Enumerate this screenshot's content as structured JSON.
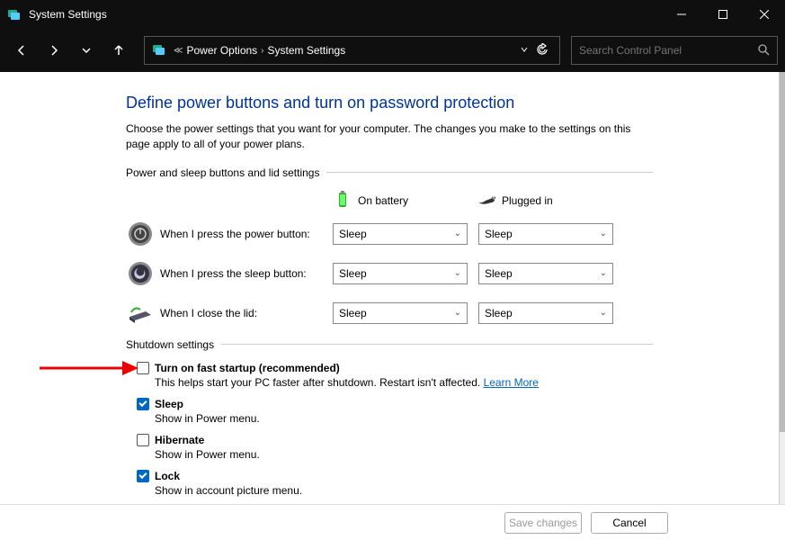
{
  "titlebar": {
    "text": "System Settings"
  },
  "breadcrumb": {
    "part1": "Power Options",
    "part2": "System Settings"
  },
  "search": {
    "placeholder": "Search Control Panel"
  },
  "page": {
    "heading": "Define power buttons and turn on password protection",
    "intro": "Choose the power settings that you want for your computer. The changes you make to the settings on this page apply to all of your power plans.",
    "section1": "Power and sleep buttons and lid settings",
    "col_battery": "On battery",
    "col_plugged": "Plugged in",
    "rows": [
      {
        "label": "When I press the power button:",
        "battery": "Sleep",
        "plugged": "Sleep"
      },
      {
        "label": "When I press the sleep button:",
        "battery": "Sleep",
        "plugged": "Sleep"
      },
      {
        "label": "When I close the lid:",
        "battery": "Sleep",
        "plugged": "Sleep"
      }
    ],
    "section2": "Shutdown settings",
    "shutdown": [
      {
        "label": "Turn on fast startup (recommended)",
        "desc": "This helps start your PC faster after shutdown. Restart isn't affected. ",
        "link": "Learn More",
        "checked": false
      },
      {
        "label": "Sleep",
        "desc": "Show in Power menu.",
        "checked": true
      },
      {
        "label": "Hibernate",
        "desc": "Show in Power menu.",
        "checked": false
      },
      {
        "label": "Lock",
        "desc": "Show in account picture menu.",
        "checked": true
      }
    ]
  },
  "footer": {
    "save": "Save changes",
    "cancel": "Cancel"
  }
}
